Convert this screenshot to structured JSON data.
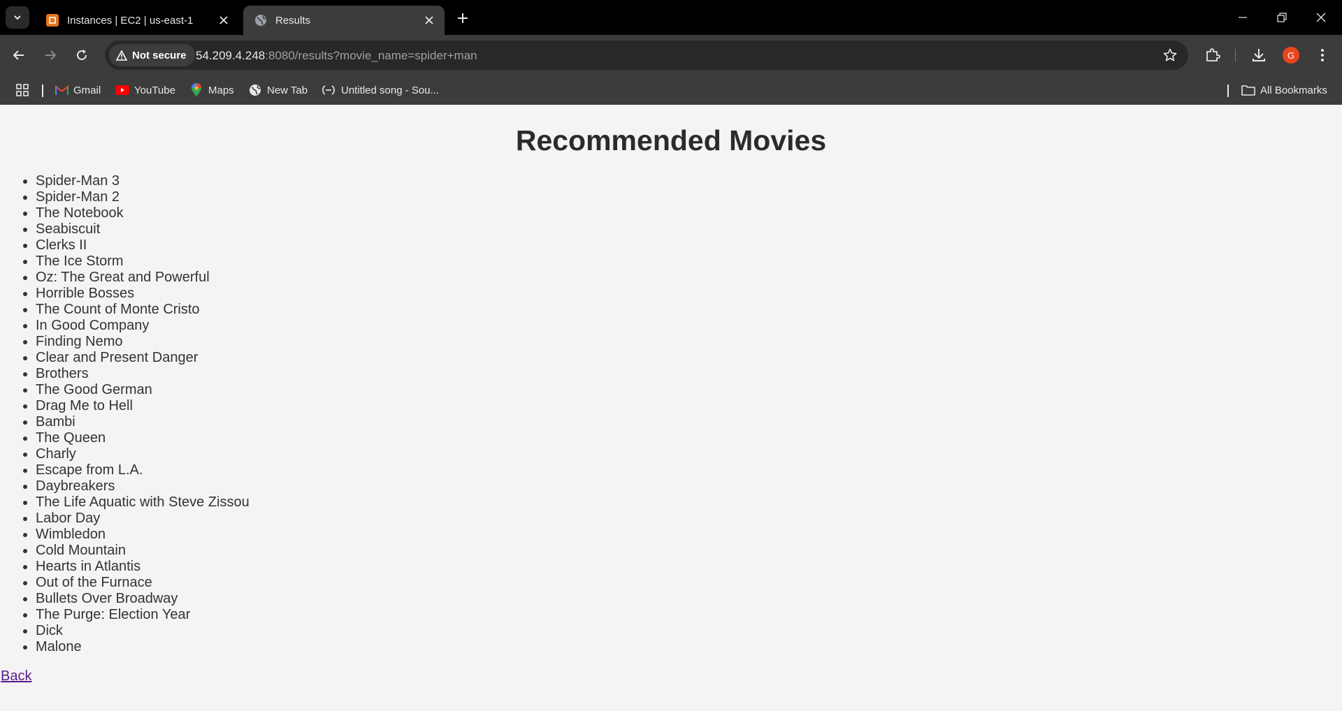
{
  "browser": {
    "tabs": [
      {
        "title": "Instances | EC2 | us-east-1",
        "favicon": "aws-ec2-icon",
        "active": false
      },
      {
        "title": "Results",
        "favicon": "globe-icon",
        "active": true
      }
    ],
    "address_bar": {
      "security_label": "Not secure",
      "url_host": "54.209.4.248",
      "url_rest": ":8080/results?movie_name=spider+man"
    },
    "profile_initial": "G",
    "bookmarks": [
      {
        "label": "Gmail",
        "icon": "gmail-icon"
      },
      {
        "label": "YouTube",
        "icon": "youtube-icon"
      },
      {
        "label": "Maps",
        "icon": "maps-icon"
      },
      {
        "label": "New Tab",
        "icon": "globe-icon"
      },
      {
        "label": "Untitled song - Sou...",
        "icon": "link-icon"
      }
    ],
    "all_bookmarks_label": "All Bookmarks"
  },
  "page": {
    "heading": "Recommended Movies",
    "movies": [
      "Spider-Man 3",
      "Spider-Man 2",
      "The Notebook",
      "Seabiscuit",
      "Clerks II",
      "The Ice Storm",
      "Oz: The Great and Powerful",
      "Horrible Bosses",
      "The Count of Monte Cristo",
      "In Good Company",
      "Finding Nemo",
      "Clear and Present Danger",
      "Brothers",
      "The Good German",
      "Drag Me to Hell",
      "Bambi",
      "The Queen",
      "Charly",
      "Escape from L.A.",
      "Daybreakers",
      "The Life Aquatic with Steve Zissou",
      "Labor Day",
      "Wimbledon",
      "Cold Mountain",
      "Hearts in Atlantis",
      "Out of the Furnace",
      "Bullets Over Broadway",
      "The Purge: Election Year",
      "Dick",
      "Malone"
    ],
    "back_link": "Back"
  }
}
